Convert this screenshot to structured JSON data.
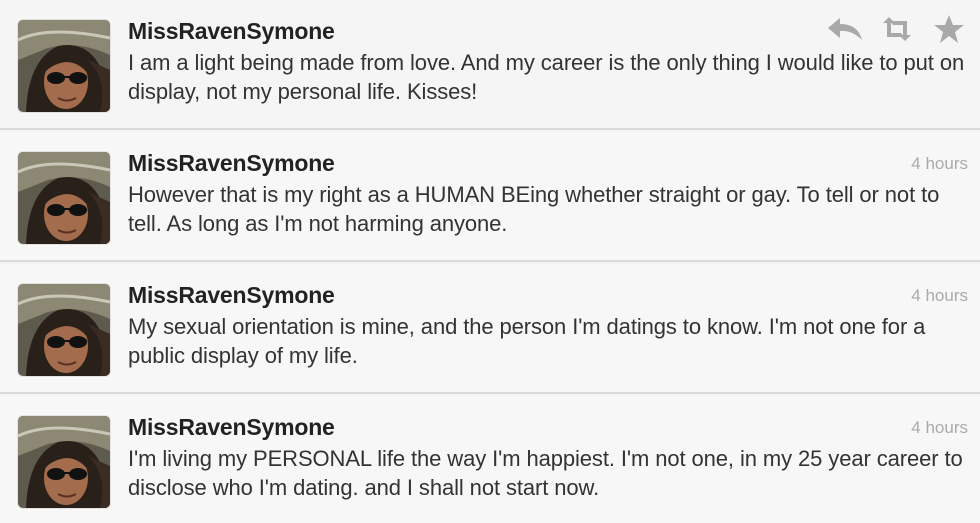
{
  "tweets": [
    {
      "username": "MissRavenSymone",
      "text": "I am a light being made from love. And my career is the only thing I would like to put on display, not my personal life. Kisses!",
      "time": ""
    },
    {
      "username": "MissRavenSymone",
      "text": "However that is my right as a HUMAN BEing whether straight or gay. To tell or not to tell. As long as I'm not harming anyone.",
      "time": "4 hours"
    },
    {
      "username": "MissRavenSymone",
      "text": "My sexual orientation is mine, and the person I'm datings to know. I'm not one for a public display of my life.",
      "time": "4 hours"
    },
    {
      "username": "MissRavenSymone",
      "text": "I'm living my PERSONAL life the way I'm happiest. I'm not one, in my 25 year career to disclose who I'm dating. and I shall not start now.",
      "time": "4 hours"
    }
  ],
  "icons": {
    "reply": "reply-icon",
    "retweet": "retweet-icon",
    "favorite": "star-icon"
  },
  "colors": {
    "username": "#222222",
    "text": "#333333",
    "timestamp": "#aaaaaa",
    "action_icon": "#a9a9a9",
    "divider": "#d9d9d9"
  }
}
